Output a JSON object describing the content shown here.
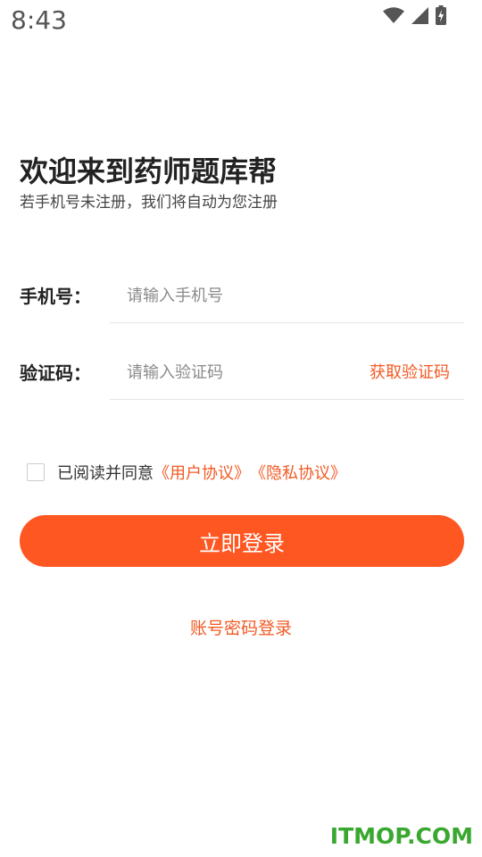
{
  "status_bar": {
    "time": "8:43",
    "icons": [
      "wifi-icon",
      "cellular-signal-icon",
      "battery-charging-icon"
    ]
  },
  "welcome": {
    "title": "欢迎来到药师题库帮",
    "subtitle": "若手机号未注册，我们将自动为您注册"
  },
  "form": {
    "phone": {
      "label": "手机号：",
      "placeholder": "请输入手机号",
      "value": ""
    },
    "code": {
      "label": "验证码：",
      "placeholder": "请输入验证码",
      "value": "",
      "get_code_label": "获取验证码"
    }
  },
  "agreement": {
    "checked": false,
    "text": "已阅读并同意",
    "user_agreement": "《用户协议》",
    "privacy_policy": "《隐私协议》"
  },
  "actions": {
    "login_label": "立即登录",
    "account_login_label": "账号密码登录"
  },
  "watermark": "ITMOP.COM",
  "colors": {
    "accent": "#ff5722",
    "link": "#f25a24",
    "watermark": "#3aa830"
  }
}
